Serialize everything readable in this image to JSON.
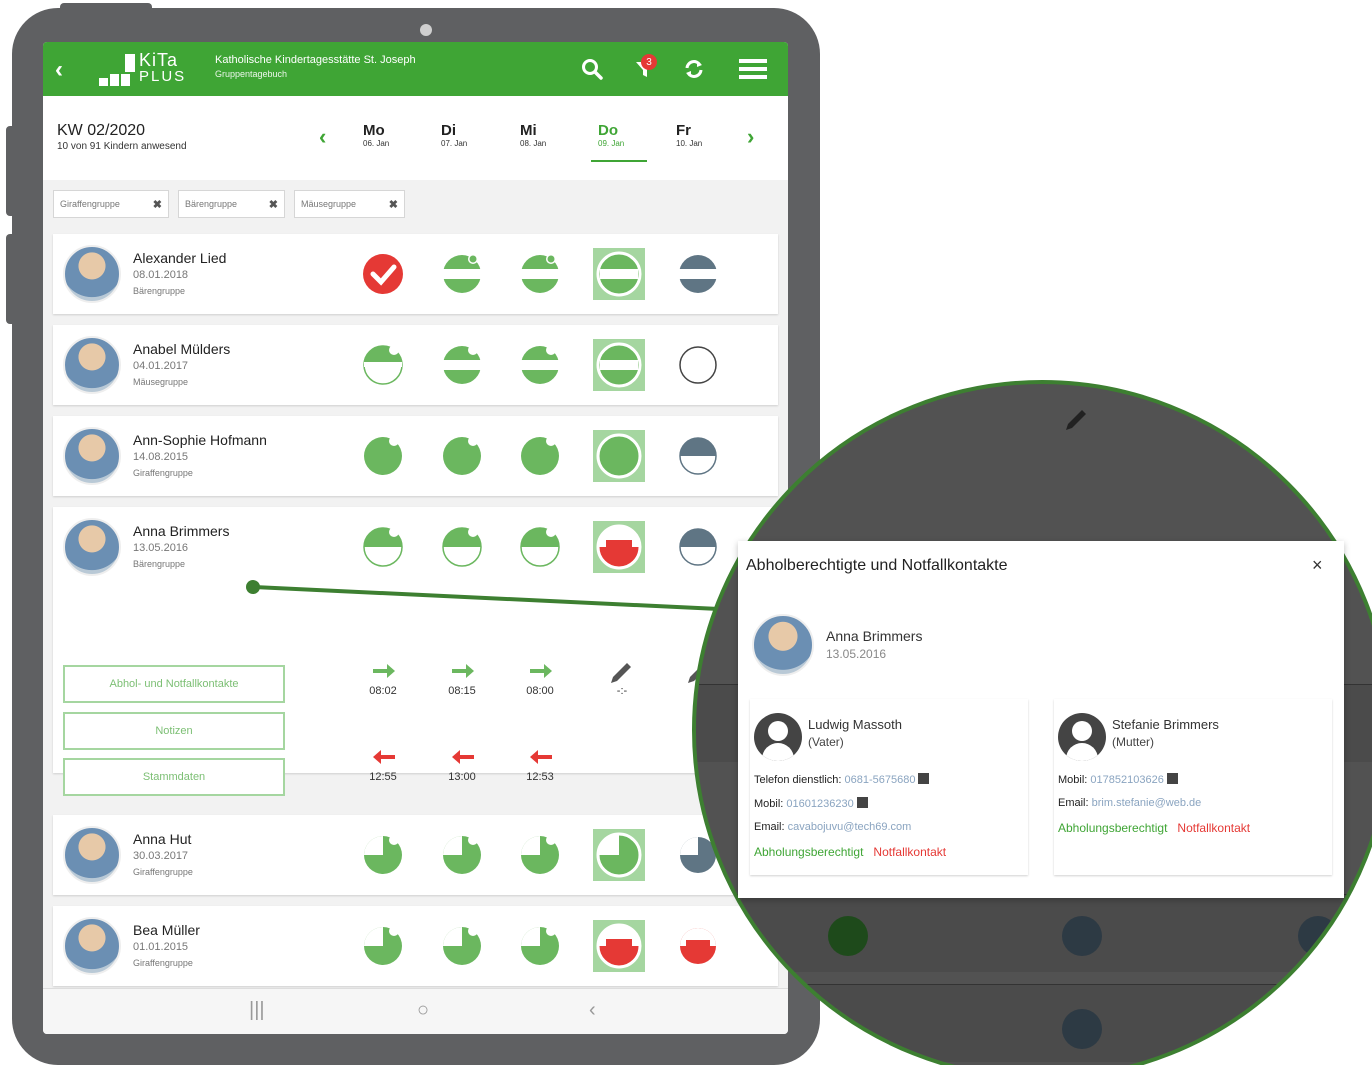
{
  "header": {
    "back": "‹",
    "logo_top": "KiTa",
    "logo_bottom": "PLUS",
    "org": "Katholische Kindertagesstätte St. Joseph",
    "subtitle": "Gruppentagebuch",
    "notif_count": "3"
  },
  "week": {
    "label": "KW 02/2020",
    "present": "10 von 91 Kindern anwesend",
    "days": [
      {
        "name": "Mo",
        "date": "06. Jan"
      },
      {
        "name": "Di",
        "date": "07. Jan"
      },
      {
        "name": "Mi",
        "date": "08. Jan"
      },
      {
        "name": "Do",
        "date": "09. Jan"
      },
      {
        "name": "Fr",
        "date": "10. Jan"
      }
    ]
  },
  "filters": [
    {
      "label": "Giraffengruppe",
      "remove": "✖"
    },
    {
      "label": "Bärengruppe",
      "remove": "✖"
    },
    {
      "label": "Mäusegruppe",
      "remove": "✖"
    }
  ],
  "children": [
    {
      "name": "Alexander Lied",
      "birth": "08.01.2018",
      "group": "Bärengruppe"
    },
    {
      "name": "Anabel Mülders",
      "birth": "04.01.2017",
      "group": "Mäusegruppe"
    },
    {
      "name": "Ann-Sophie Hofmann",
      "birth": "14.08.2015",
      "group": "Giraffengruppe"
    },
    {
      "name": "Anna Brimmers",
      "birth": "13.05.2016",
      "group": "Bärengruppe"
    },
    {
      "name": "Anna Hut",
      "birth": "30.03.2017",
      "group": "Giraffengruppe"
    },
    {
      "name": "Bea Müller",
      "birth": "01.01.2015",
      "group": "Giraffengruppe"
    }
  ],
  "expanded": {
    "buttons": [
      "Abhol- und Notfallkontakte",
      "Notizen",
      "Stammdaten"
    ],
    "arrivals": [
      "08:02",
      "08:15",
      "08:00"
    ],
    "departures": [
      "12:55",
      "13:00",
      "12:53"
    ],
    "empty_time": "-:-"
  },
  "colors": {
    "brand": "#3fa535",
    "alert": "#e53935",
    "neutral": "#5f7584"
  },
  "dialog": {
    "title": "Abholberechtigte und Notfallkontakte",
    "close": "×",
    "child_name": "Anna Brimmers",
    "child_birth": "13.05.2016",
    "contacts": [
      {
        "name": "Ludwig Massoth",
        "role": "(Vater)",
        "lines": [
          {
            "label": "Telefon dienstlich: ",
            "value": "0681-5675680"
          },
          {
            "label": "Mobil: ",
            "value": "01601236230"
          },
          {
            "label": "Email: ",
            "value": "cavabojuvu@tech69.com"
          }
        ],
        "tag1": "Abholungsberechtigt",
        "tag2": "Notfallkontakt"
      },
      {
        "name": "Stefanie Brimmers",
        "role": "(Mutter)",
        "lines": [
          {
            "label": "Mobil: ",
            "value": "017852103626"
          },
          {
            "label": "Email: ",
            "value": "brim.stefanie@web.de"
          }
        ],
        "tag1": "Abholungsberechtigt",
        "tag2": "Notfallkontakt"
      }
    ]
  }
}
